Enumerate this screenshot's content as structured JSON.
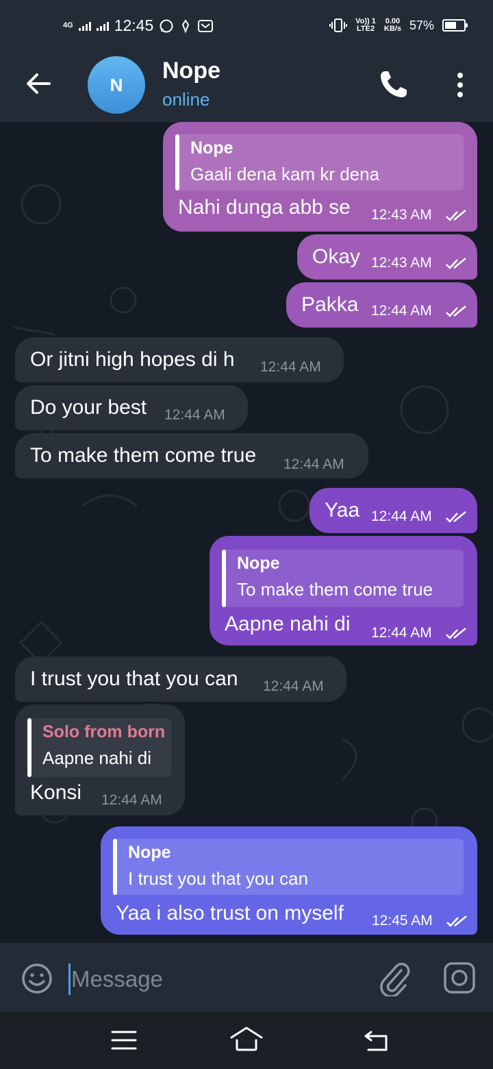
{
  "status_bar": {
    "network": "4G",
    "time": "12:45",
    "volte_top": "Vo)) 1",
    "volte_bottom": "LTE2",
    "speed_value": "0.00",
    "speed_unit": "KB/s",
    "battery": "57%"
  },
  "header": {
    "avatar_letter": "N",
    "name": "Nope",
    "status": "online"
  },
  "messages": [
    {
      "direction": "out",
      "reply_name": "Nope",
      "reply_text": "Gaali dena kam kr dena",
      "text": "Nahi dunga abb se",
      "time": "12:43 AM",
      "read": true
    },
    {
      "direction": "out",
      "text": "Okay",
      "time": "12:43 AM",
      "read": true
    },
    {
      "direction": "out",
      "text": "Pakka",
      "time": "12:44 AM",
      "read": true
    },
    {
      "direction": "in",
      "text": "Or jitni high hopes di h",
      "time": "12:44 AM"
    },
    {
      "direction": "in",
      "text": "Do your best",
      "time": "12:44 AM"
    },
    {
      "direction": "in",
      "text": "To make them come true",
      "time": "12:44 AM"
    },
    {
      "direction": "out",
      "text": "Yaa",
      "time": "12:44 AM",
      "read": true
    },
    {
      "direction": "out",
      "reply_name": "Nope",
      "reply_text": "To make them come true",
      "text": "Aapne nahi di",
      "time": "12:44 AM",
      "read": true
    },
    {
      "direction": "in",
      "text": "I trust you that you can",
      "time": "12:44 AM"
    },
    {
      "direction": "in",
      "reply_name": "Solo from born",
      "reply_text": "Aapne nahi di",
      "text": "Konsi",
      "time": "12:44 AM"
    },
    {
      "direction": "out",
      "reply_name": "Nope",
      "reply_text": "I trust you that you can",
      "text": "Yaa i also trust on myself",
      "time": "12:45 AM",
      "read": true
    }
  ],
  "input": {
    "placeholder": "Message"
  },
  "icons": {
    "back": "arrow-left-icon",
    "call": "phone-icon",
    "menu": "more-vertical-icon",
    "emoji": "smile-icon",
    "attach": "paperclip-icon",
    "camera": "camera-icon",
    "read": "double-check-icon"
  },
  "colors": {
    "bubble_out_top": "#a35fb4",
    "bubble_out_mid": "#7f47c6",
    "bubble_out_bottom": "#6466e7",
    "bubble_in": "#29303a",
    "accent": "#5fb1ef",
    "reply_name_incoming": "#e07a93"
  }
}
